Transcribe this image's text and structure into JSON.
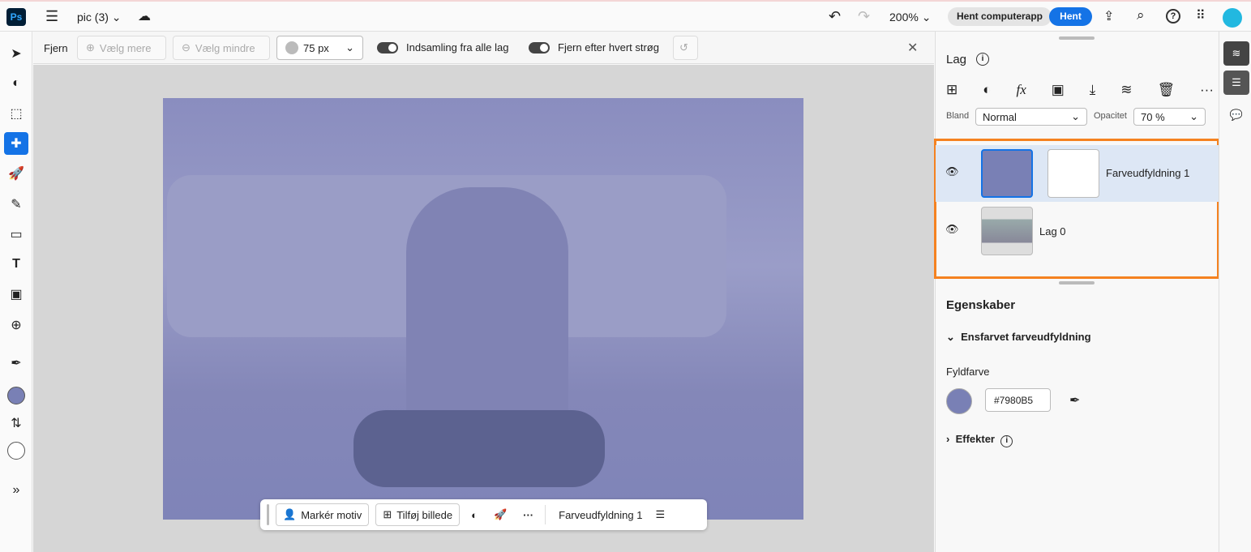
{
  "topbar": {
    "app": "Ps",
    "doc_title": "pic (3)",
    "zoom": "200%",
    "get_desktop": "Hent computerapp",
    "get": "Hent"
  },
  "options": {
    "tool": "Fjern",
    "add": "Vælg mere",
    "subtract": "Vælg mindre",
    "brush_size": "75 px",
    "sample_all": "Indsamling fra alle lag",
    "remove_after": "Fjern efter hvert strøg"
  },
  "context": {
    "select_subject": "Markér motiv",
    "add_image": "Tilføj billede",
    "layer_name": "Farveudfyldning 1"
  },
  "layers": {
    "title": "Lag",
    "blend_label": "Bland",
    "blend": "Normal",
    "opacity_label": "Opacitet",
    "opacity": "70 %",
    "items": [
      {
        "name": "Farveudfyldning 1",
        "selected": true
      },
      {
        "name": "Lag 0",
        "selected": false
      }
    ]
  },
  "properties": {
    "title": "Egenskaber",
    "section": "Ensfarvet farveudfyldning",
    "fill_label": "Fyldfarve",
    "fill_hex": "#7980B5",
    "effects": "Effekter"
  },
  "colors": {
    "accent": "#1473e6",
    "fill": "#7980B5",
    "highlight": "#f58220"
  }
}
